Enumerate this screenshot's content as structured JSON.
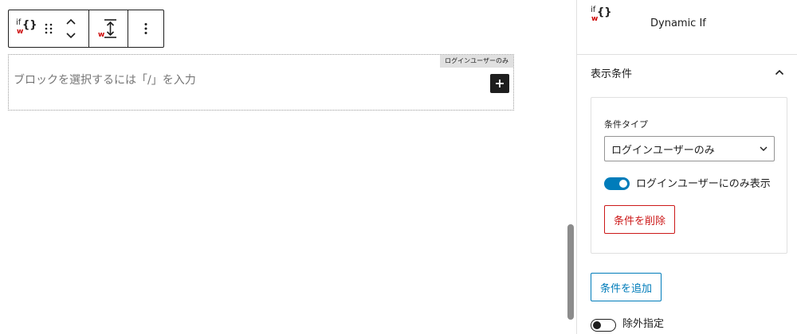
{
  "toolbar": {
    "block_icon": {
      "if_text": "if",
      "brace_text": "{}",
      "mark_text": "w",
      "name": "dynamic-if-icon"
    },
    "icons": [
      "drag-handle-icon",
      "move-up-icon",
      "move-down-icon",
      "align-vertical-icon",
      "more-options-icon"
    ]
  },
  "block": {
    "tag": "ログインユーザーのみ",
    "placeholder": "ブロックを選択するには「/」を入力",
    "add_label": "+"
  },
  "sidebar": {
    "header": {
      "block_icon": {
        "if_text": "if",
        "brace_text": "{}",
        "mark_text": "w"
      },
      "title": "Dynamic If"
    },
    "panel": {
      "title": "表示条件",
      "expanded": true,
      "condition": {
        "type_label": "条件タイプ",
        "type_value": "ログインユーザーのみ",
        "toggle_label": "ログインユーザーにのみ表示",
        "toggle_on": true,
        "delete_label": "条件を削除"
      },
      "add_label": "条件を追加",
      "exclude_label": "除外指定",
      "exclude_on": false
    }
  },
  "colors": {
    "accent": "#007cba",
    "danger": "#cc1818",
    "dark": "#1e1e1e",
    "border": "#e0e0e0",
    "tag_bg": "#e0e0e0"
  }
}
